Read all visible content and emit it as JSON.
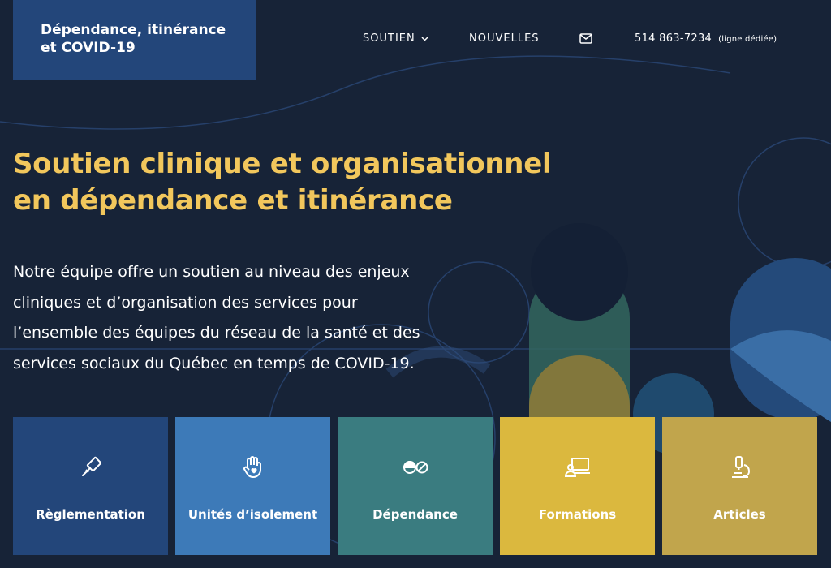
{
  "header": {
    "logo_line1": "Dépendance, itinérance",
    "logo_line2": "et COVID-19",
    "nav": {
      "soutien_label": "SOUTIEN",
      "nouvelles_label": "NOUVELLES",
      "mail_icon": "envelope-icon",
      "phone": "514 863-7234",
      "phone_note": "(ligne dédiée)"
    }
  },
  "hero": {
    "headline_line1": "Soutien clinique et organisationnel",
    "headline_line2": "en dépendance et itinérance",
    "intro_lines": [
      "Notre équipe offre un soutien au niveau des enjeux",
      "cliniques et d’organisation des services pour",
      "l’ensemble des équipes du réseau de la santé et des",
      "services sociaux du Québec en temps de COVID-19."
    ]
  },
  "tiles": [
    {
      "label": "Règlementation",
      "icon": "gavel-icon",
      "color": "#23467a"
    },
    {
      "label": "Unités d’isolement",
      "icon": "hand-heart-icon",
      "color": "#3d7ab8"
    },
    {
      "label": "Dépendance",
      "icon": "pills-icon",
      "color": "#3a7c80"
    },
    {
      "label": "Formations",
      "icon": "laptop-user-icon",
      "color": "#dbb83e"
    },
    {
      "label": "Articles",
      "icon": "microscope-icon",
      "color": "#c1a54c"
    }
  ],
  "colors": {
    "background": "#172337",
    "headline": "#f2c75c",
    "logo_bg": "#23467a"
  }
}
